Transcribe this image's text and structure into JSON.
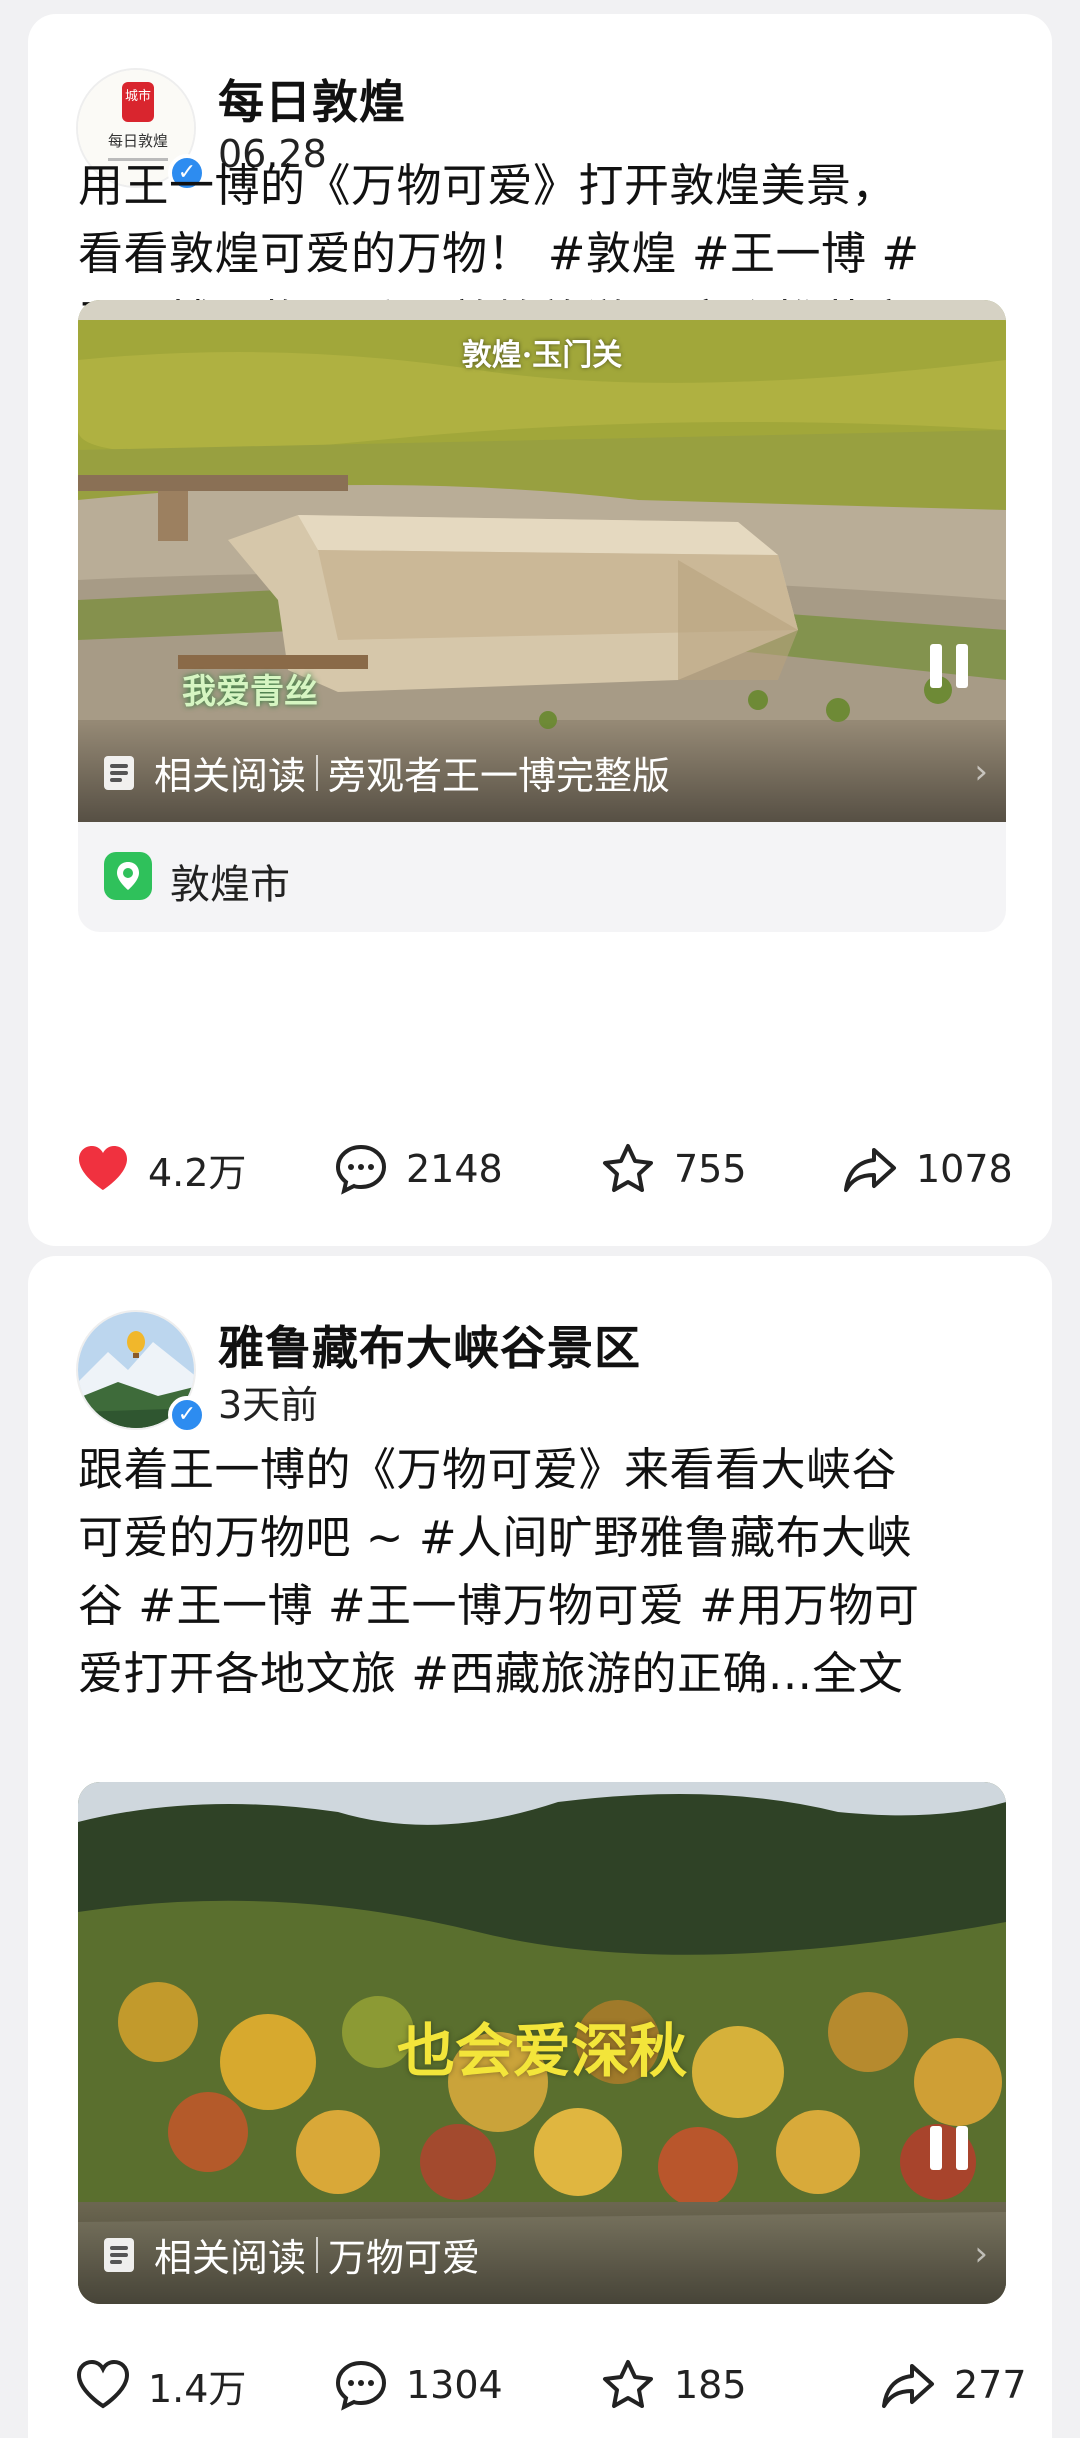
{
  "posts": [
    {
      "author": "每日敦煌",
      "time": "06.28",
      "avatar_text": "每日敦煌",
      "avatar_badge": "城市",
      "text_lines": [
        "用王一博的《万物可爱》打开敦煌美景，",
        "看看敦煌可爱的万物！ #敦煌 #王一博 #",
        "王一博万物可爱 #敦煌旅游 #家乡推荐官"
      ],
      "video_title": "敦煌·玉门关",
      "video_caption": "我爱青丝",
      "related_label": "相关阅读",
      "related_title": "旁观者王一博完整版",
      "location": "敦煌市",
      "likes": "4.2万",
      "comments": "2148",
      "favorites": "755",
      "shares": "1078",
      "liked": true
    },
    {
      "author": "雅鲁藏布大峡谷景区",
      "time": "3天前",
      "text_lines": [
        "跟着王一博的《万物可爱》来看看大峡谷",
        "可爱的万物吧 ~ #人间旷野雅鲁藏布大峡",
        "谷 #王一博 #王一博万物可爱 #用万物可",
        "爱打开各地文旅 #西藏旅游的正确...全文"
      ],
      "video_title": "也会爱深秋",
      "related_label": "相关阅读",
      "related_title": "万物可爱",
      "likes": "1.4万",
      "comments": "1304",
      "favorites": "185",
      "shares": "277",
      "liked": false
    }
  ],
  "colors": {
    "like_active": "#f0313f",
    "verify": "#2d8cf0",
    "location_icon": "#2fc15b"
  }
}
